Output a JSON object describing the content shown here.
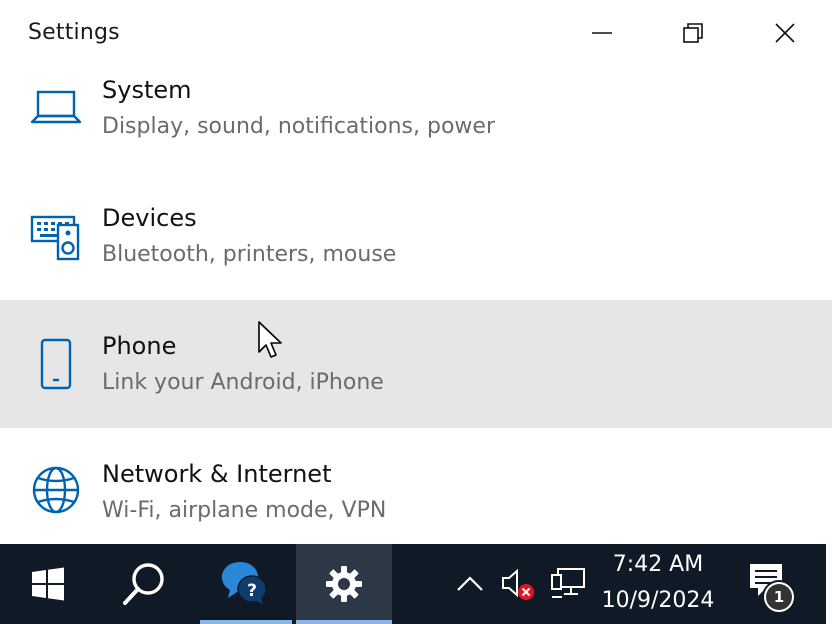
{
  "window": {
    "title": "Settings"
  },
  "items": [
    {
      "label": "System",
      "desc": "Display, sound, notifications, power",
      "icon": "laptop-icon"
    },
    {
      "label": "Devices",
      "desc": "Bluetooth, printers, mouse",
      "icon": "keyboard-speaker-icon"
    },
    {
      "label": "Phone",
      "desc": "Link your Android, iPhone",
      "icon": "phone-icon"
    },
    {
      "label": "Network & Internet",
      "desc": "Wi-Fi, airplane mode, VPN",
      "icon": "globe-icon"
    }
  ],
  "taskbar": {
    "time": "7:42 AM",
    "date": "10/9/2024",
    "notification_count": "1"
  },
  "colors": {
    "accent": "#0063b1",
    "taskbar_bg": "#0f1a26",
    "hover_bg": "#e6e6e6"
  }
}
